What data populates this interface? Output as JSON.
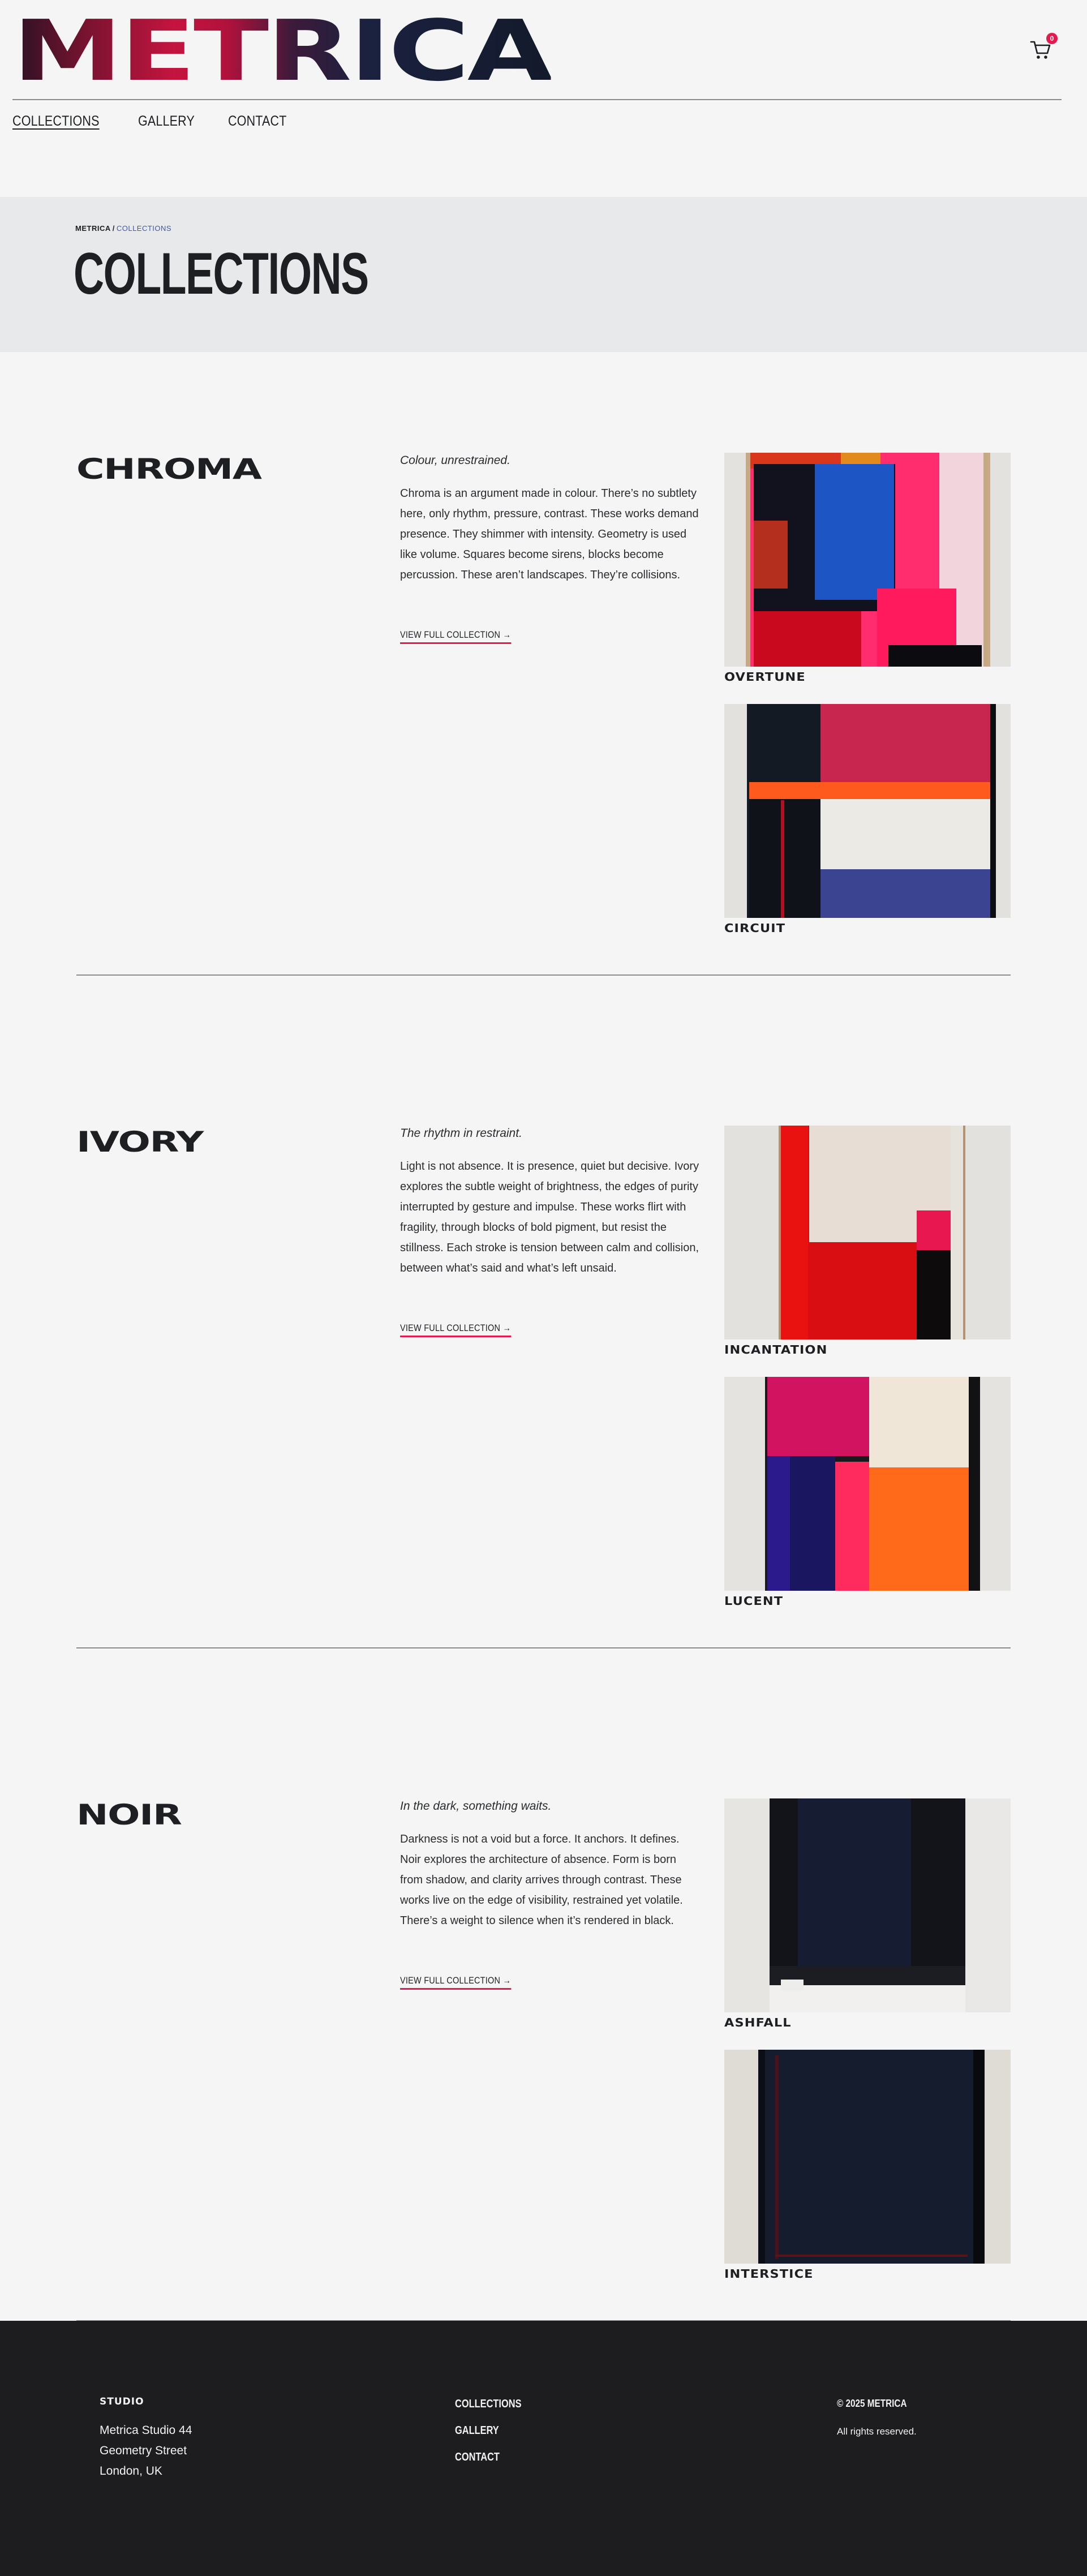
{
  "brand": {
    "logo_text": "METRICA",
    "accent": "#e6194f"
  },
  "cart": {
    "icon": "cart-icon",
    "count": "0"
  },
  "nav": {
    "items": [
      "COLLECTIONS",
      "GALLERY",
      "CONTACT"
    ]
  },
  "hero": {
    "breadcrumb_home": "METRICA",
    "breadcrumb_sep": "/",
    "breadcrumb_current": "COLLECTIONS",
    "title": "COLLECTIONS"
  },
  "collections": [
    {
      "name": "CHROMA",
      "tagline": "Colour, unrestrained.",
      "description": "Chroma is an argument made in colour. There’s no subtlety here, only rhythm, pressure, contrast. These works demand presence. They shimmer with intensity. Geometry is used like volume. Squares become sirens, blocks become percussion. These aren’t landscapes. They’re collisions.",
      "link": "VIEW FULL COLLECTION →",
      "artworks": [
        "OVERTUNE",
        "CIRCUIT"
      ]
    },
    {
      "name": "IVORY",
      "tagline": "The rhythm in restraint.",
      "description": "Light is not absence. It is presence, quiet but decisive. Ivory explores the subtle weight of brightness, the edges of purity interrupted by gesture and impulse. These works flirt with fragility, through blocks of bold pigment, but resist the stillness. Each stroke is tension between calm and collision, between what’s said and what’s left unsaid.",
      "link": "VIEW FULL COLLECTION →",
      "artworks": [
        "INCANTATION",
        "LUCENT"
      ]
    },
    {
      "name": "NOIR",
      "tagline": "In the dark, something waits.",
      "description": "Darkness is not a void but a force. It anchors. It defines. Noir explores the architecture of absence. Form is born from shadow, and clarity arrives through contrast. These works live on the edge of visibility, restrained yet volatile. There’s a weight to silence when it’s rendered in black.",
      "link": "VIEW FULL COLLECTION →",
      "artworks": [
        "ASHFALL",
        "INTERSTICE"
      ]
    }
  ],
  "footer": {
    "studio_heading": "STUDIO",
    "address": "Metrica Studio 44 Geometry Street London, UK",
    "nav": [
      "COLLECTIONS",
      "GALLERY",
      "CONTACT"
    ],
    "copyright": "© 2025 METRICA",
    "rights": "All rights reserved."
  }
}
